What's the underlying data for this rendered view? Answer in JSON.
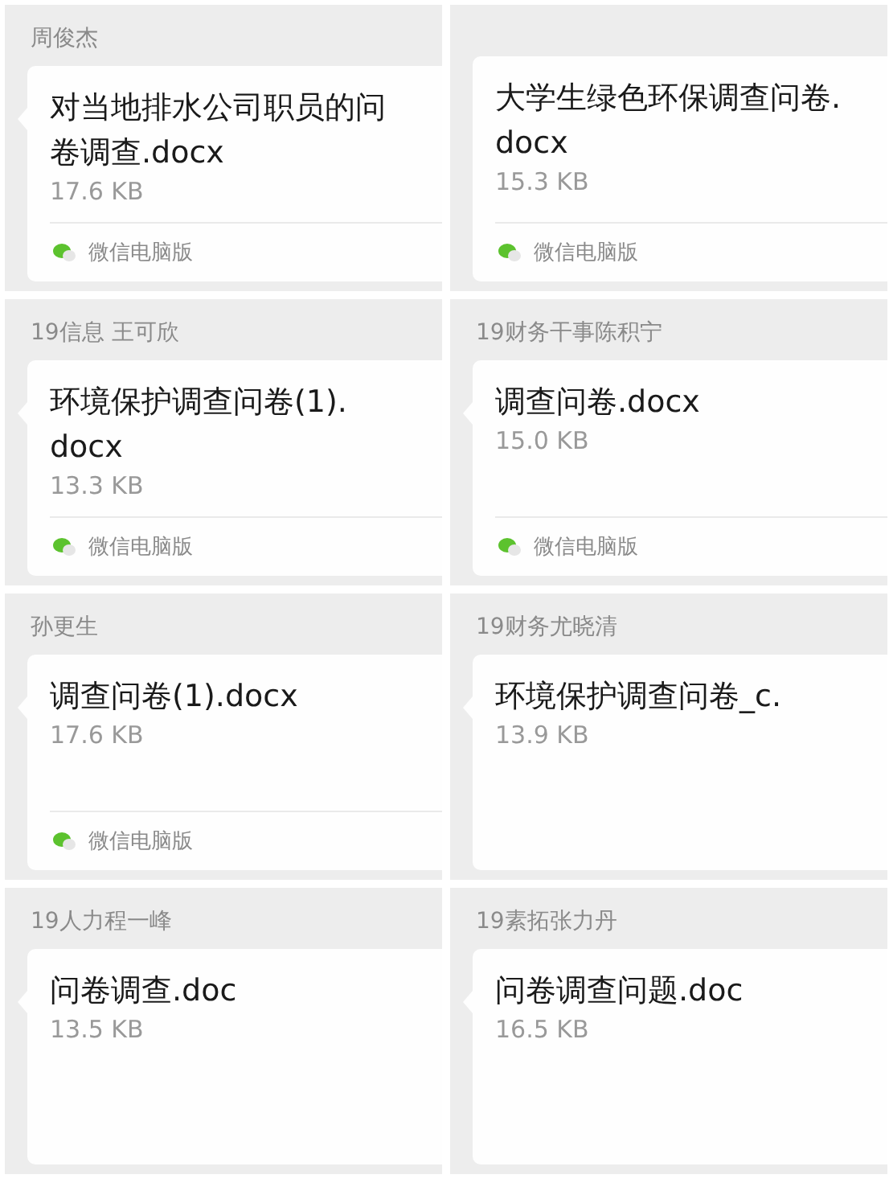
{
  "columns": [
    {
      "messages": [
        {
          "sender": "周俊杰",
          "tail": true,
          "file_name_lines": [
            "对当地排水公司职员的问",
            "卷调查.docx"
          ],
          "file_size": "17.6 KB",
          "source": "微信电脑版"
        },
        {
          "sender": "19信息 王可欣",
          "tail": true,
          "file_name_lines": [
            "环境保护调查问卷(1).",
            "docx"
          ],
          "file_size": "13.3 KB",
          "source": "微信电脑版"
        },
        {
          "sender": "孙更生",
          "tail": true,
          "file_name_lines": [
            "调查问卷(1).docx"
          ],
          "file_size": "17.6 KB",
          "source": "微信电脑版"
        },
        {
          "sender": "19人力程一峰",
          "tail": true,
          "file_name_lines": [
            "问卷调查.doc"
          ],
          "file_size": "13.5 KB"
        }
      ]
    },
    {
      "messages": [
        {
          "tail": false,
          "file_name_lines": [
            "大学生绿色环保调查问卷.",
            "docx"
          ],
          "file_size": "15.3 KB",
          "source": "微信电脑版"
        },
        {
          "sender": "19财务干事陈积宁",
          "tail": true,
          "file_name_lines": [
            "调查问卷.docx"
          ],
          "file_size": "15.0 KB",
          "source": "微信电脑版"
        },
        {
          "sender": "19财务尤晓清",
          "tail": true,
          "file_name_lines": [
            "环境保护调查问卷_c."
          ],
          "file_size": "13.9 KB"
        },
        {
          "sender": "19素拓张力丹",
          "tail": true,
          "file_name_lines": [
            "问卷调查问题.doc"
          ],
          "file_size": "16.5 KB"
        }
      ]
    }
  ]
}
